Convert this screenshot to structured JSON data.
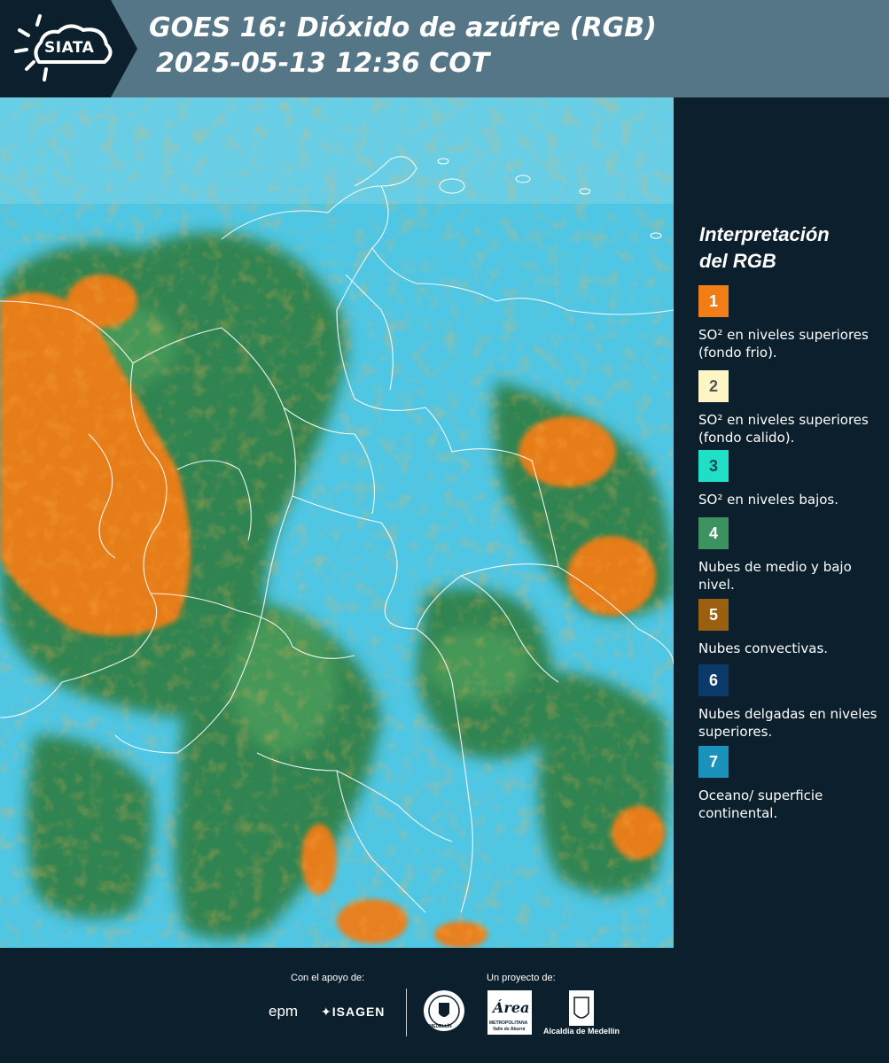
{
  "header": {
    "logo_text": "SIATA",
    "title_line1": "GOES 16: Dióxido de azúfre (RGB)",
    "title_line2": "2025-05-13 12:36 COT"
  },
  "legend": {
    "title_line1": "Interpretación",
    "title_line2": "del RGB",
    "items": [
      {
        "number": "1",
        "color": "#f07d16",
        "text_color": "#ffffff",
        "label": "SO² en niveles superiores (fondo frio)."
      },
      {
        "number": "2",
        "color": "#fdf5c4",
        "text_color": "#555555",
        "label": "SO² en niveles superiores (fondo calido)."
      },
      {
        "number": "3",
        "color": "#1fe0c6",
        "text_color": "#1a4a50",
        "label": "SO² en niveles bajos."
      },
      {
        "number": "4",
        "color": "#3d9360",
        "text_color": "#ffffff",
        "label": "Nubes de medio y bajo nivel."
      },
      {
        "number": "5",
        "color": "#9a5f10",
        "text_color": "#ffffff",
        "label": "Nubes convectivas."
      },
      {
        "number": "6",
        "color": "#0b3a6a",
        "text_color": "#ffffff",
        "label": "Nubes delgadas en niveles superiores."
      },
      {
        "number": "7",
        "color": "#1a92ba",
        "text_color": "#ffffff",
        "label": "Oceano/ superficie continental."
      }
    ]
  },
  "footer": {
    "support_caption": "Con el apoyo de:",
    "project_caption": "Un proyecto de:",
    "logo_epm": "epm",
    "logo_isagen": "ISAGEN",
    "logo_medellin_seal_text": "MEDELLÍN",
    "logo_area": "Área",
    "logo_area_sub1": "METROPOLITANA",
    "logo_area_sub2": "Valle de Aburrá",
    "logo_alcaldia": "Alcaldía de Medellín"
  },
  "colors": {
    "ocean": "#4fc6e3",
    "cloud_green": "#2f7f45",
    "so2_orange": "#f07d16",
    "header_bg": "#557686",
    "panel_bg": "#0b1f2c"
  }
}
